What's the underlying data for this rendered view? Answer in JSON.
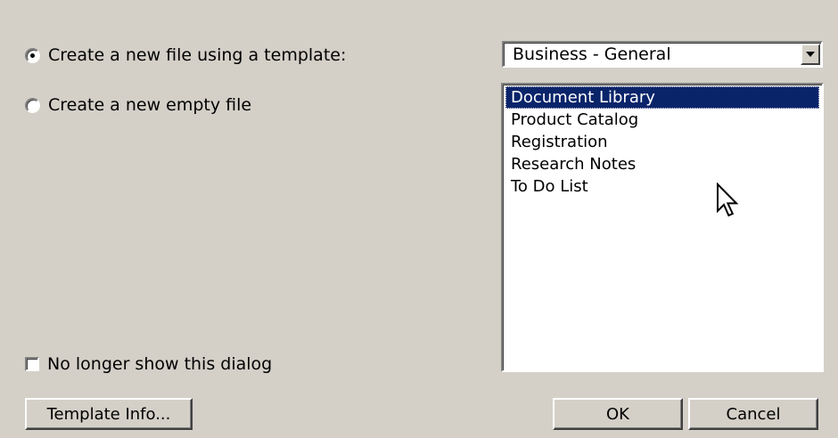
{
  "options": {
    "template_radio": {
      "label": "Create a new file using a template:",
      "selected": true
    },
    "empty_radio": {
      "label": "Create a new empty file",
      "selected": false
    }
  },
  "category_select": {
    "value": "Business - General"
  },
  "template_list": {
    "items": [
      "Document Library",
      "Product Catalog",
      "Registration",
      "Research Notes",
      "To Do List"
    ],
    "selected_index": 0
  },
  "no_longer_show": {
    "label": "No longer show this dialog",
    "checked": false
  },
  "buttons": {
    "template_info": "Template Info...",
    "ok": "OK",
    "cancel": "Cancel"
  },
  "colors": {
    "dialog_bg": "#d4d0c8",
    "selection_bg": "#0a246a",
    "selection_fg": "#ffffff"
  },
  "icons": {
    "cursor": "mouse-pointer-icon",
    "dropdown": "chevron-down-icon"
  }
}
